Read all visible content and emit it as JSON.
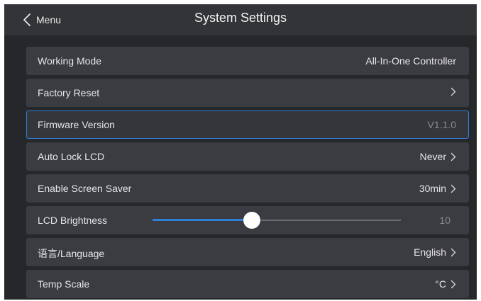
{
  "header": {
    "back_label": "Menu",
    "title": "System Settings"
  },
  "rows": [
    {
      "label": "Working Mode",
      "value": "All-In-One Controller",
      "chevron": false
    },
    {
      "label": "Factory Reset",
      "value": "",
      "chevron": true
    },
    {
      "label": "Firmware Version",
      "value": "V1.1.0",
      "chevron": false,
      "selected": true
    },
    {
      "label": "Auto Lock LCD",
      "value": "Never",
      "chevron": true
    },
    {
      "label": "Enable Screen Saver",
      "value": "30min",
      "chevron": true
    },
    {
      "label": "LCD Brightness",
      "value": "10",
      "slider_fraction": 0.4
    },
    {
      "label": "语言/Language",
      "value": "English",
      "chevron": true
    },
    {
      "label": "Temp Scale",
      "value": "°C",
      "chevron": true
    }
  ],
  "colors": {
    "accent": "#2f7fd6",
    "background": "#26272b",
    "row": "#3b3c41"
  },
  "icons": {
    "back": "chevron-left-icon",
    "row_more": "chevron-right-icon",
    "slider_knob": "slider-thumb"
  }
}
